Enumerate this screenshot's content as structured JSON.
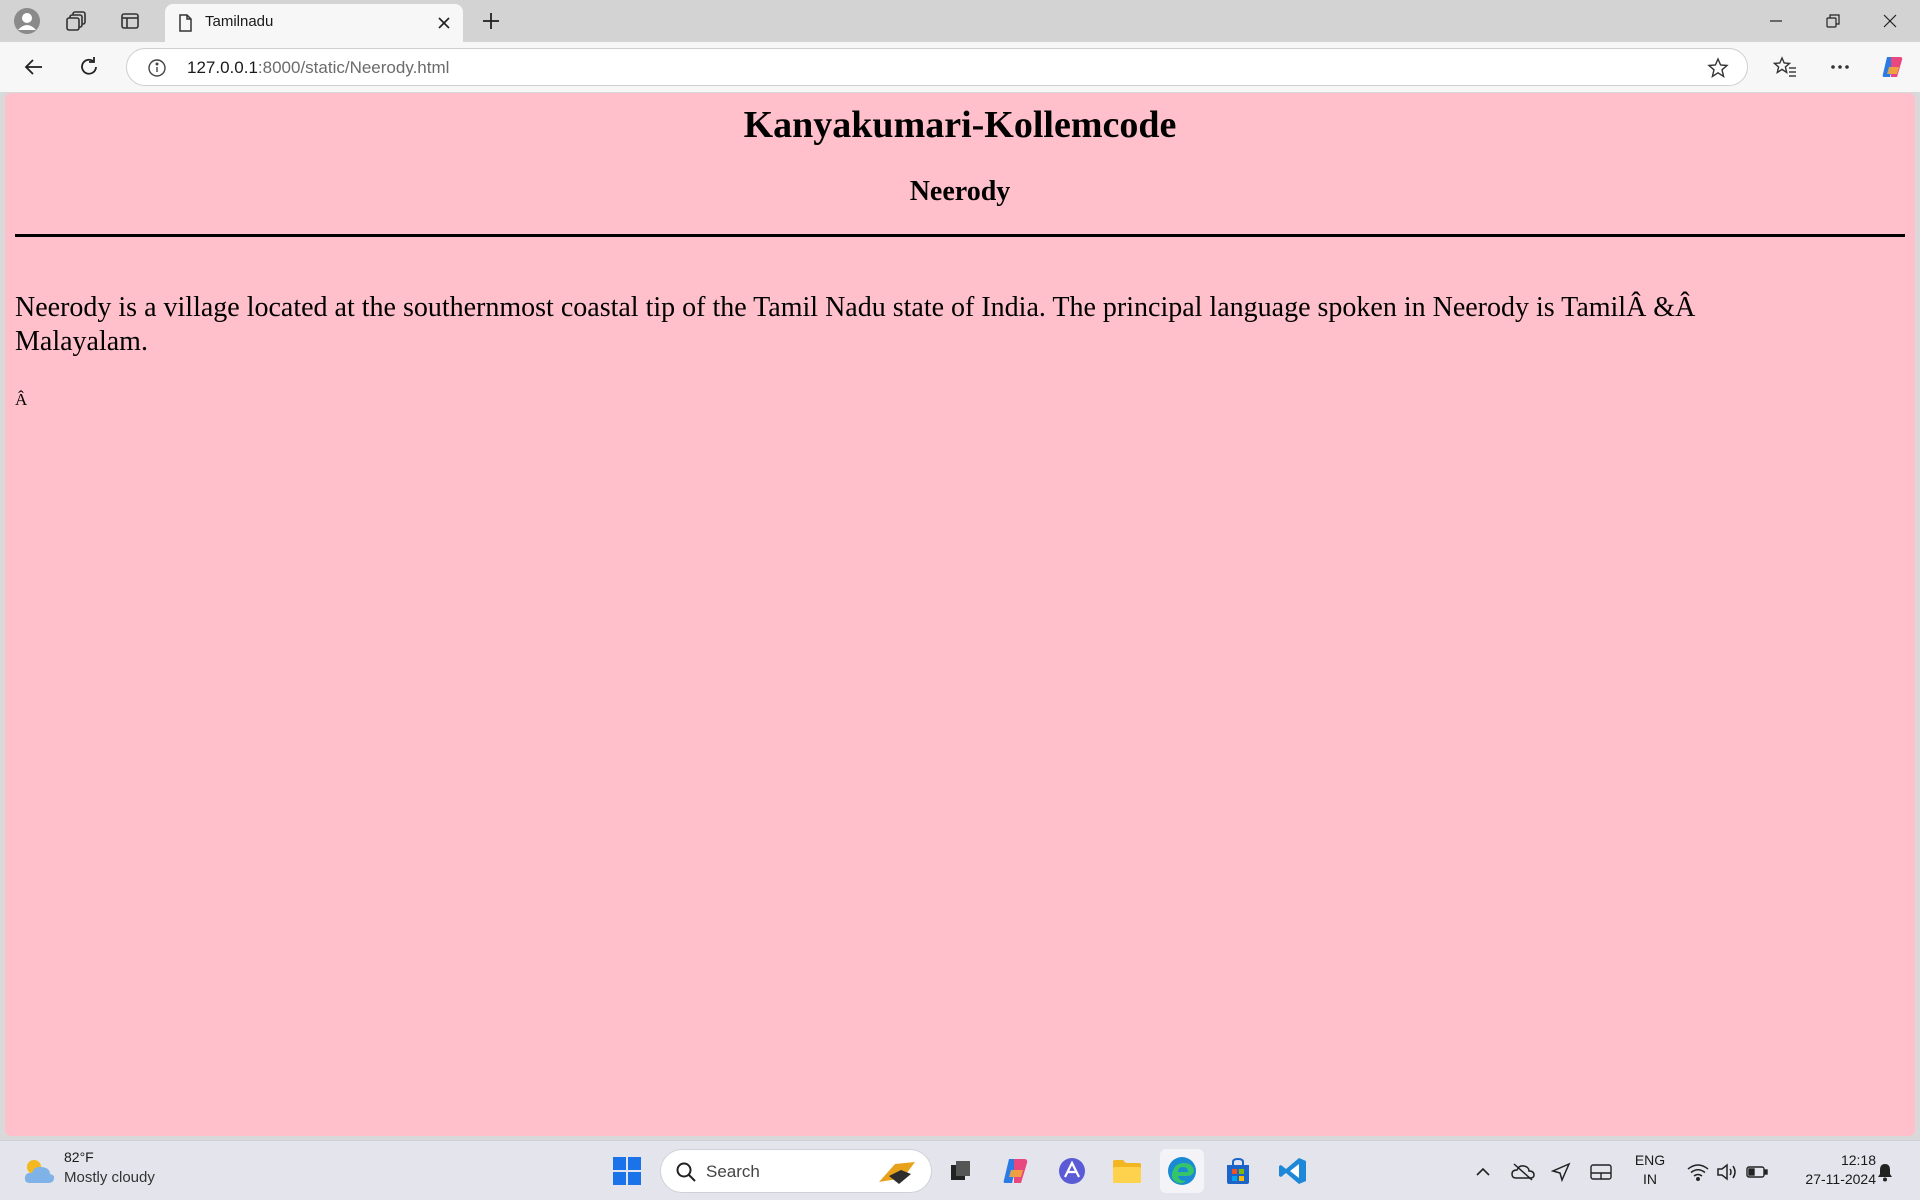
{
  "browser": {
    "tab_title": "Tamilnadu",
    "url_host": "127.0.0.1",
    "url_rest": ":8000/static/Neerody.html"
  },
  "page": {
    "heading": "Kanyakumari-Kollemcode",
    "subheading": "Neerody",
    "paragraph": "Neerody is a village located at the southernmost coastal tip of the Tamil Nadu state of India. The principal language spoken in Neerody is TamilÂ &Â Malayalam.",
    "small_text": "Â",
    "background_color": "#ffc0cb"
  },
  "taskbar": {
    "weather_temp": "82°F",
    "weather_desc": "Mostly cloudy",
    "search_label": "Search",
    "lang_line1": "ENG",
    "lang_line2": "IN",
    "time": "12:18",
    "date": "27-11-2024"
  }
}
